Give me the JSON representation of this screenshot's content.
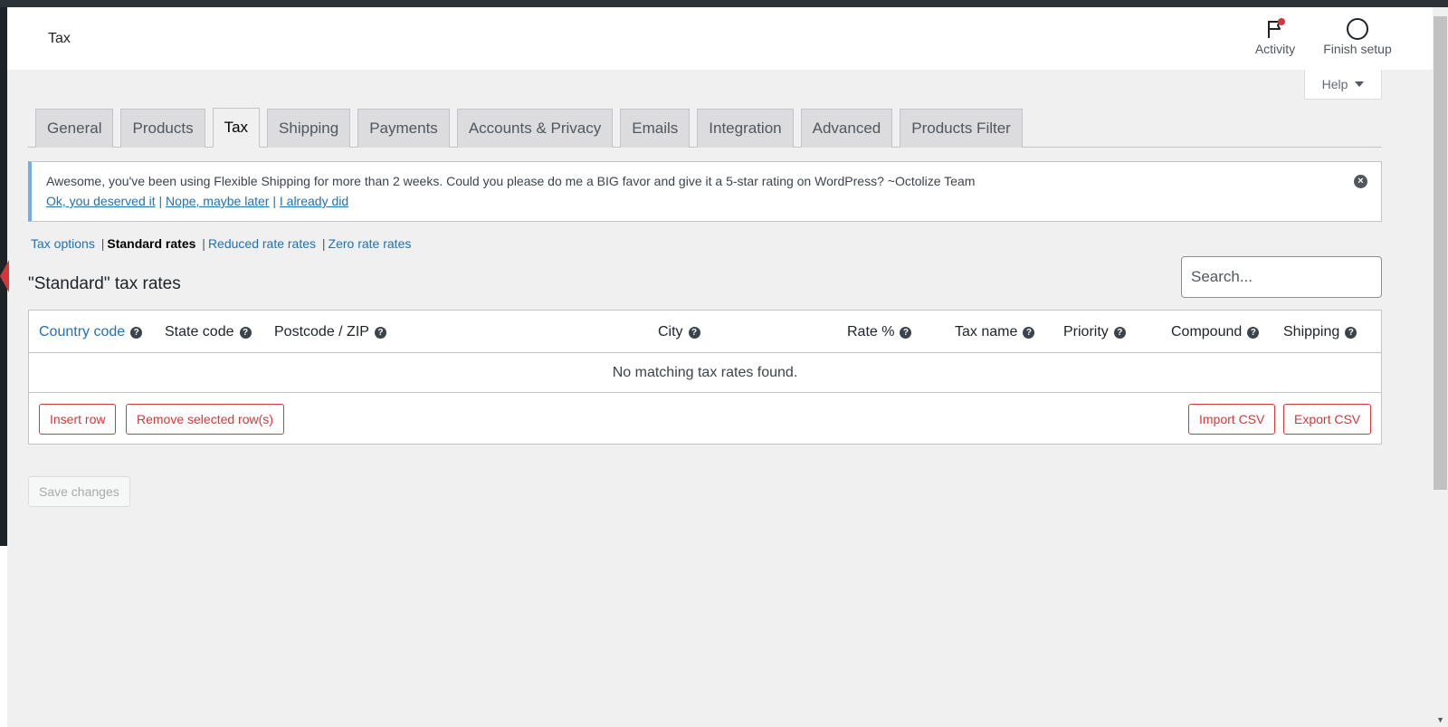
{
  "header": {
    "title": "Tax",
    "activity_label": "Activity",
    "finish_setup_label": "Finish setup",
    "help_label": "Help"
  },
  "tabs": [
    {
      "label": "General"
    },
    {
      "label": "Products"
    },
    {
      "label": "Tax",
      "active": true
    },
    {
      "label": "Shipping"
    },
    {
      "label": "Payments"
    },
    {
      "label": "Accounts & Privacy"
    },
    {
      "label": "Emails"
    },
    {
      "label": "Integration"
    },
    {
      "label": "Advanced"
    },
    {
      "label": "Products Filter"
    }
  ],
  "notice": {
    "message": "Awesome, you've been using Flexible Shipping for more than 2 weeks. Could you please do me a BIG favor and give it a 5-star rating on WordPress? ~Octolize Team",
    "link_ok": "Ok, you deserved it",
    "link_later": "Nope, maybe later",
    "link_did": "I already did",
    "separator": "|"
  },
  "subnav": {
    "tax_options": "Tax options",
    "standard_rates": "Standard rates",
    "reduced_rates": "Reduced rate rates",
    "zero_rates": "Zero rate rates",
    "separator": "|"
  },
  "section": {
    "title": "\"Standard\" tax rates",
    "search_placeholder": "Search..."
  },
  "table": {
    "columns": [
      "Country code",
      "State code",
      "Postcode / ZIP",
      "City",
      "Rate %",
      "Tax name",
      "Priority",
      "Compound",
      "Shipping"
    ],
    "empty_message": "No matching tax rates found.",
    "insert_row": "Insert row",
    "remove_rows": "Remove selected row(s)",
    "import_csv": "Import CSV",
    "export_csv": "Export CSV"
  },
  "save_label": "Save changes",
  "colors": {
    "accent": "#2271b1",
    "danger": "#d63638",
    "notice_border": "#72aee6"
  }
}
